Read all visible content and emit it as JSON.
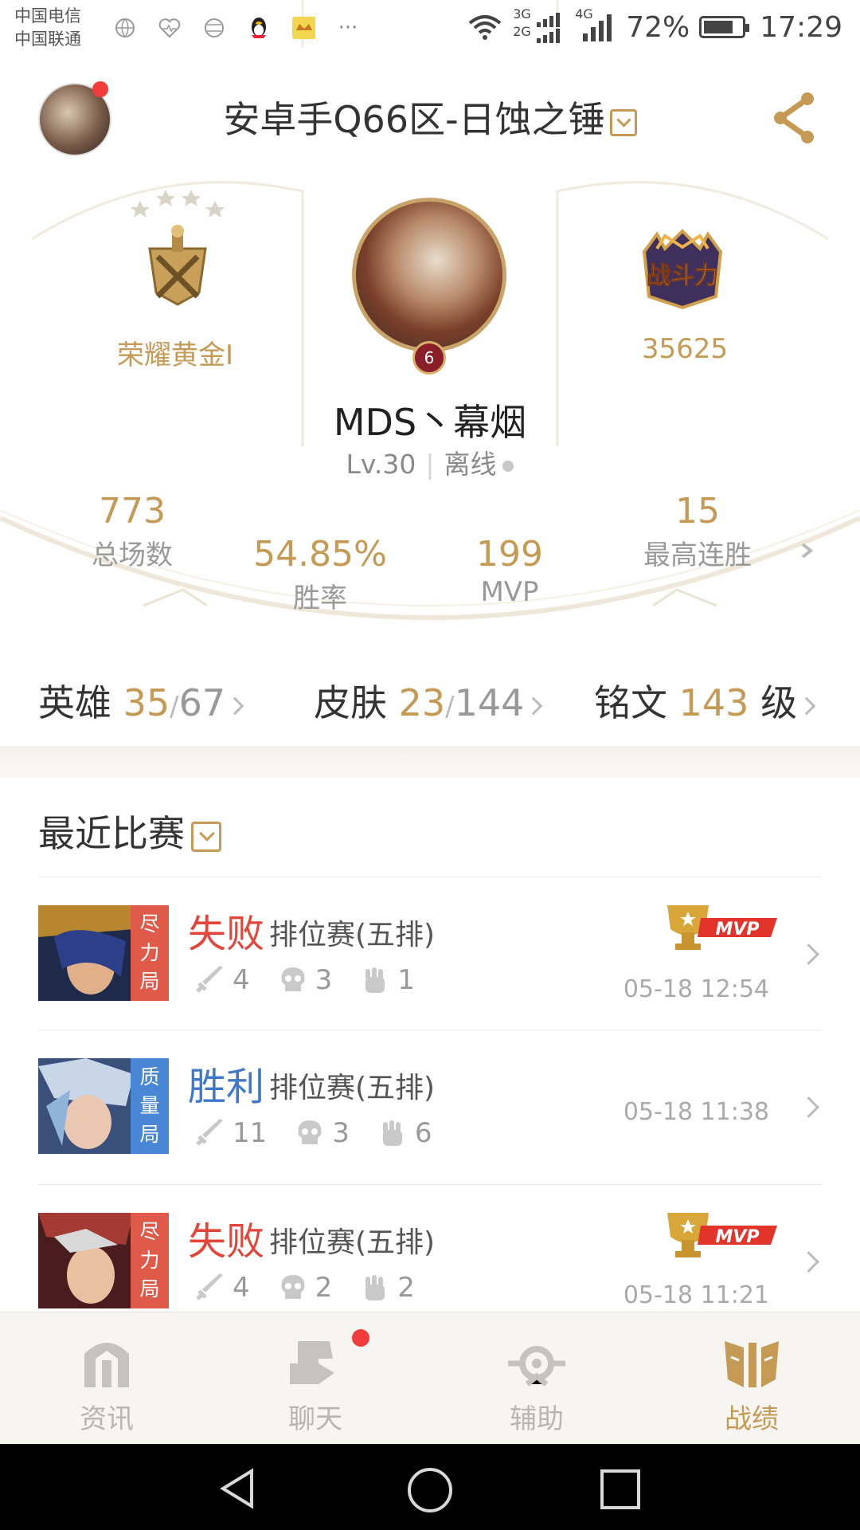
{
  "status_bar": {
    "carrier1": "中国电信",
    "carrier2": "中国联通",
    "net1": "3G",
    "net2": "2G",
    "net3": "4G",
    "battery": "72%",
    "time": "17:29"
  },
  "header": {
    "server": "安卓手Q66区-日蚀之锤",
    "rank_label": "荣耀黄金I",
    "power_value": "35625",
    "power_badge_text": "战斗力",
    "level_badge": "6",
    "player_name": "MDS丶幕烟",
    "player_level": "Lv.30",
    "player_status": "离线"
  },
  "stats": {
    "total": {
      "value": "773",
      "label": "总场数"
    },
    "winrate": {
      "value": "54.85%",
      "label": "胜率"
    },
    "mvp": {
      "value": "199",
      "label": "MVP"
    },
    "streak": {
      "value": "15",
      "label": "最高连胜"
    }
  },
  "counts": {
    "heroes": {
      "label": "英雄",
      "owned": "35",
      "total": "67"
    },
    "skins": {
      "label": "皮肤",
      "owned": "23",
      "total": "144"
    },
    "inscription": {
      "label": "铭文",
      "value": "143",
      "unit": "级"
    }
  },
  "recent": {
    "title": "最近比赛",
    "matches": [
      {
        "tag": "尽力局",
        "result": "失败",
        "mode": "排位赛(五排)",
        "kills": "4",
        "deaths": "3",
        "assists": "1",
        "time": "05-18 12:54",
        "mvp": true
      },
      {
        "tag": "质量局",
        "result": "胜利",
        "mode": "排位赛(五排)",
        "kills": "11",
        "deaths": "3",
        "assists": "6",
        "time": "05-18 11:38",
        "mvp": false
      },
      {
        "tag": "尽力局",
        "result": "失败",
        "mode": "排位赛(五排)",
        "kills": "4",
        "deaths": "2",
        "assists": "2",
        "time": "05-18 11:21",
        "mvp": true
      }
    ],
    "mvp_badge": "MVP"
  },
  "nav": {
    "news": "资讯",
    "chat": "聊天",
    "assist": "辅助",
    "record": "战绩"
  },
  "colors": {
    "gold": "#c49a55",
    "loss": "#e2463a",
    "win": "#3f78c9",
    "loss_tag": "#e05a4a",
    "win_tag": "#4a86d6"
  }
}
